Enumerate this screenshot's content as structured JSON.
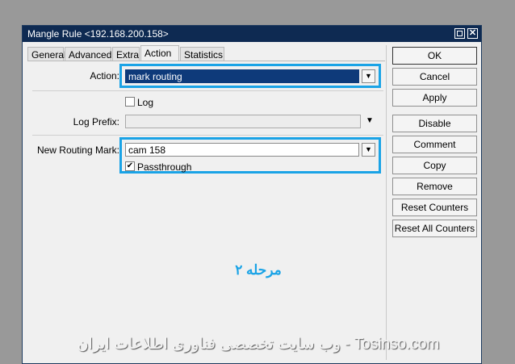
{
  "window": {
    "title": "Mangle Rule <192.168.200.158>"
  },
  "tabs": [
    {
      "label": "General"
    },
    {
      "label": "Advanced"
    },
    {
      "label": "Extra"
    },
    {
      "label": "Action"
    },
    {
      "label": "Statistics"
    }
  ],
  "form": {
    "action_label": "Action:",
    "action_value": "mark routing",
    "log_label": "Log",
    "log_checked": false,
    "log_prefix_label": "Log Prefix:",
    "log_prefix_value": "",
    "routing_mark_label": "New Routing Mark:",
    "routing_mark_value": "cam 158",
    "passthrough_label": "Passthrough",
    "passthrough_checked": true
  },
  "buttons": {
    "ok": "OK",
    "cancel": "Cancel",
    "apply": "Apply",
    "disable": "Disable",
    "comment": "Comment",
    "copy": "Copy",
    "remove": "Remove",
    "reset_counters": "Reset Counters",
    "reset_all_counters": "Reset All Counters"
  },
  "annotation": {
    "step_text": "مرحله ۲"
  },
  "watermark": {
    "text": "وب سایت تخصصی فناوری اطلاعات ایران - Tosinso.com"
  },
  "icons": {
    "dropdown": "▼",
    "check": "✔",
    "close": "✕"
  },
  "colors": {
    "titlebar": "#0e2a52",
    "highlight": "#1aa3e6",
    "selection": "#0e3a7a"
  }
}
